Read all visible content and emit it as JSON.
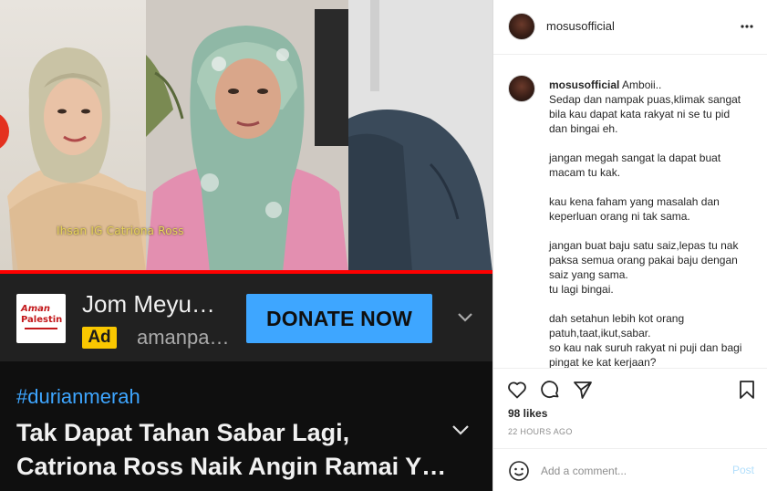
{
  "video": {
    "watermark": "Ihsan IG Catriona Ross",
    "progress_fraction": 1.0
  },
  "ad": {
    "logo_line1": "Aman",
    "logo_line2": "Palestin",
    "title": "Jom Meyu…",
    "badge": "Ad",
    "domain": "amanpa…",
    "cta": "DONATE NOW"
  },
  "yt": {
    "hashtag": "#durianmerah",
    "title_line1": "Tak Dapat Tahan Sabar Lagi,",
    "title_line2": "Catriona Ross Naik Angin Ramai Y…"
  },
  "post": {
    "username": "mosusofficial",
    "caption_lines": [
      "Amboii..",
      "Sedap dan nampak puas,klimak sangat bila kau dapat kata rakyat ni se tu pid dan bingai eh.",
      "jangan megah sangat la dapat buat macam tu kak.",
      "kau kena faham yang masalah dan keperluan orang ni tak sama.",
      "jangan buat baju satu saiz,lepas tu nak paksa semua orang pakai baju dengan saiz yang sama.",
      "tu lagi bingai.",
      "dah setahun lebih kot orang patuh,taat,ikut,sabar.",
      "so kau nak suruh rakyat ni puji dan bagi pingat ke kat kerjaan?"
    ],
    "likes": "98 likes",
    "time": "22 HOURS AGO",
    "comment_placeholder": "Add a comment...",
    "post_label": "Post"
  },
  "icons": {
    "more": "more-horizontal-icon",
    "like": "heart-icon",
    "comment": "comment-icon",
    "share": "send-icon",
    "save": "bookmark-icon",
    "emoji": "emoji-icon",
    "chevron": "chevron-down-icon"
  },
  "colors": {
    "yt_link_blue": "#3ea6ff",
    "ad_badge_yellow": "#f9c700",
    "video_progress_red": "#ff0000",
    "ig_post_disabled": "#b2dffc"
  }
}
